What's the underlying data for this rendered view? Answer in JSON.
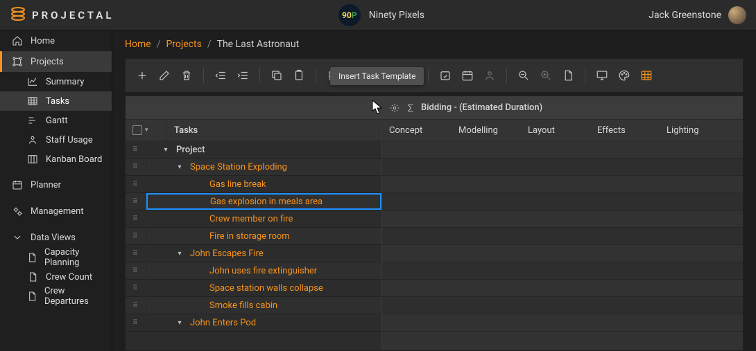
{
  "app": {
    "name": "PROJECTAL"
  },
  "workspace": {
    "badge_digits": "90",
    "badge_letter": "P",
    "name": "Ninety Pixels"
  },
  "user": {
    "name": "Jack Greenstone"
  },
  "breadcrumbs": {
    "home": "Home",
    "projects": "Projects",
    "current": "The Last Astronaut"
  },
  "sidebar": {
    "home": "Home",
    "projects": "Projects",
    "projects_children": {
      "summary": "Summary",
      "tasks": "Tasks",
      "gantt": "Gantt",
      "staff_usage": "Staff Usage",
      "kanban": "Kanban Board"
    },
    "planner": "Planner",
    "management": "Management",
    "data_views": "Data Views",
    "data_views_children": {
      "capacity": "Capacity Planning",
      "crew_count": "Crew Count",
      "crew_departures": "Crew Departures"
    }
  },
  "tooltip": {
    "insert_template": "Insert Task Template"
  },
  "panel": {
    "right_title": "Bidding - (Estimated Duration)",
    "tasks_header": "Tasks",
    "columns": {
      "concept": "Concept",
      "modelling": "Modelling",
      "layout": "Layout",
      "effects": "Effects",
      "lighting": "Lighting"
    }
  },
  "tasks": [
    {
      "label": "Project",
      "level": 0,
      "expander": "down",
      "link": false
    },
    {
      "label": "Space Station Exploding",
      "level": 1,
      "expander": "down",
      "link": true
    },
    {
      "label": "Gas line break",
      "level": 2,
      "expander": "",
      "link": true
    },
    {
      "label": "Gas explosion in meals area",
      "level": 2,
      "expander": "",
      "link": true,
      "selected": true
    },
    {
      "label": "Crew member on fire",
      "level": 2,
      "expander": "",
      "link": true
    },
    {
      "label": "Fire in storage room",
      "level": 2,
      "expander": "",
      "link": true
    },
    {
      "label": "John Escapes Fire",
      "level": 1,
      "expander": "down",
      "link": true
    },
    {
      "label": "John uses fire extinguisher",
      "level": 2,
      "expander": "",
      "link": true
    },
    {
      "label": "Space station walls collapse",
      "level": 2,
      "expander": "",
      "link": true
    },
    {
      "label": "Smoke fills cabin",
      "level": 2,
      "expander": "",
      "link": true
    },
    {
      "label": "John Enters Pod",
      "level": 1,
      "expander": "down",
      "link": true
    }
  ]
}
